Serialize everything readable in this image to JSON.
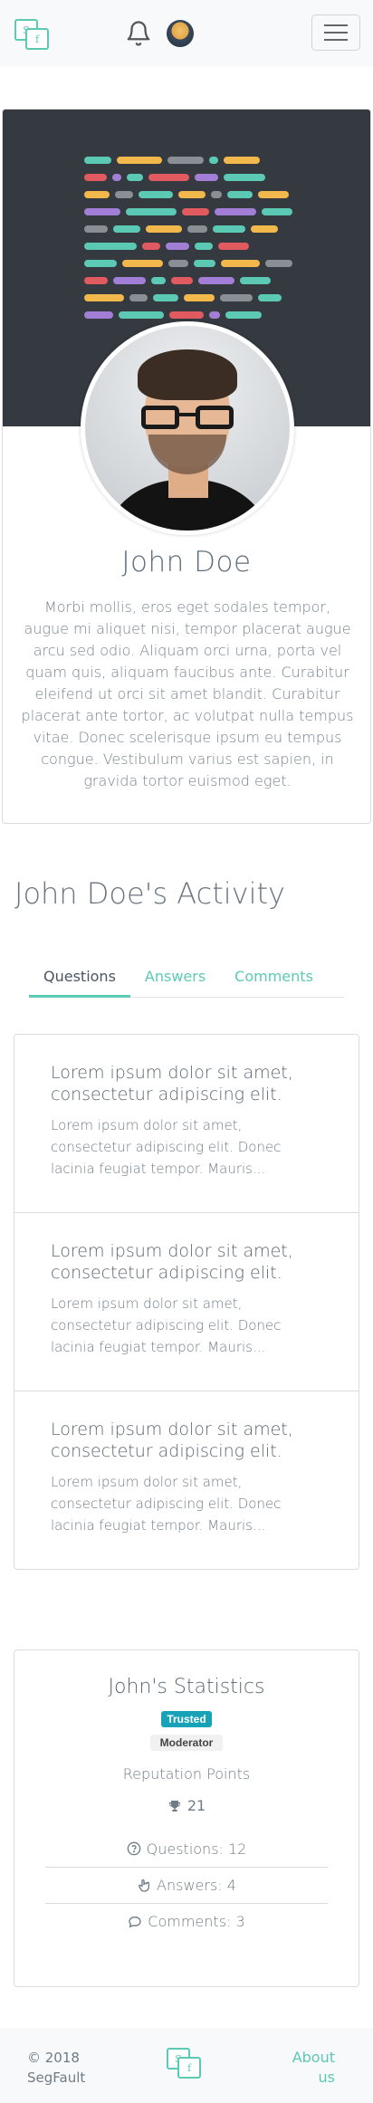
{
  "navbar": {
    "logo_letters": [
      "S",
      "f"
    ],
    "bell_icon": "bell-icon",
    "avatar_icon": "user-avatar",
    "toggler_icon": "hamburger-icon"
  },
  "profile": {
    "name": "John Doe",
    "bio": "Morbi mollis, eros eget sodales tempor, augue mi aliquet nisi, tempor placerat augue arcu sed odio. Aliquam orci urna, porta vel quam quis, aliquam faucibus ante. Curabitur eleifend ut orci sit amet blandit. Curabitur placerat ante tortor, ac volutpat nulla tempus vitae. Donec scelerisque ipsum eu tempus congue. Vestibulum varius est sapien, in gravida tortor euismod eget."
  },
  "activity": {
    "title": "John Doe's Activity",
    "tabs": [
      {
        "label": "Questions",
        "active": true
      },
      {
        "label": "Answers",
        "active": false
      },
      {
        "label": "Comments",
        "active": false
      }
    ],
    "questions": [
      {
        "title": "Lorem ipsum dolor sit amet, consectetur adipiscing elit.",
        "excerpt": "Lorem ipsum dolor sit amet, consectetur adipiscing elit. Donec lacinia feugiat tempor. Mauris..."
      },
      {
        "title": "Lorem ipsum dolor sit amet, consectetur adipiscing elit.",
        "excerpt": "Lorem ipsum dolor sit amet, consectetur adipiscing elit. Donec lacinia feugiat tempor. Mauris..."
      },
      {
        "title": "Lorem ipsum dolor sit amet, consectetur adipiscing elit.",
        "excerpt": "Lorem ipsum dolor sit amet, consectetur adipiscing elit. Donec lacinia feugiat tempor. Mauris..."
      }
    ]
  },
  "stats": {
    "title": "John's Statistics",
    "badges": {
      "trusted": "Trusted",
      "moderator": "Moderator"
    },
    "reputation_label": "Reputation Points",
    "reputation_value": "21",
    "questions": "Questions: 12",
    "answers": "Answers: 4",
    "comments": "Comments: 3"
  },
  "footer": {
    "copyright": "© 2018 SegFault",
    "about": "About us"
  },
  "colors": {
    "accent": "#5cc9b5",
    "cover": "#343a40",
    "trusted_badge": "#17a2b8"
  }
}
